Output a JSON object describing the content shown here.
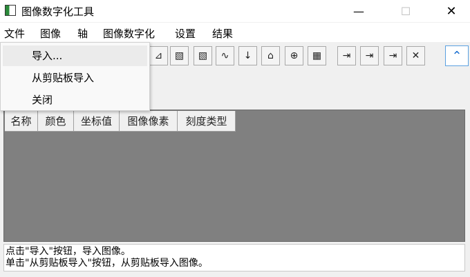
{
  "window": {
    "title": "图像数字化工具",
    "min_glyph": "—",
    "max_glyph": "☐",
    "close_glyph": "✕"
  },
  "menubar": {
    "items": [
      "文件",
      "图像",
      "轴",
      "图像数字化",
      "设置",
      "结果"
    ]
  },
  "file_menu": {
    "items": [
      "导入...",
      "从剪贴板导入",
      "关闭"
    ],
    "highlighted": "导入..."
  },
  "toolbar": {
    "icons": [
      "axis-icon",
      "crop-icon",
      "crop-alt-icon",
      "curve-icon",
      "sort-icon",
      "tag-icon",
      "add-page-icon",
      "grid-delete-icon",
      "import-column-icon",
      "import-axis-icon",
      "import-curve-icon",
      "delete-icon"
    ],
    "collapse_glyph": "⌃"
  },
  "table": {
    "columns": [
      "名称",
      "颜色",
      "坐标值",
      "图像像素",
      "刻度类型"
    ]
  },
  "status": {
    "lines": [
      "点击\"导入\"按钮，导入图像。",
      "单击\"从剪贴板导入\"按钮，从剪贴板导入图像。"
    ]
  }
}
